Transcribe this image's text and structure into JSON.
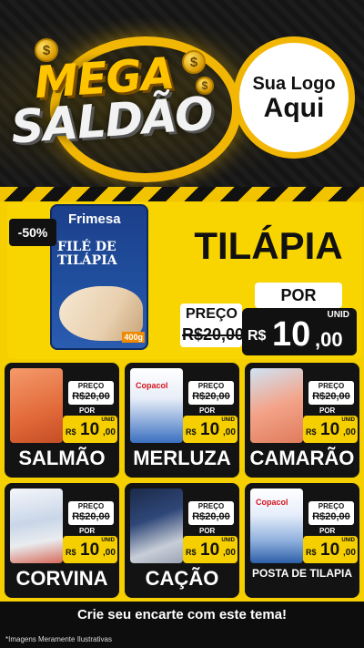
{
  "header": {
    "mega": "MEGA",
    "saldao": "SALDÃO",
    "coin_symbol": "$",
    "logo_line1": "Sua Logo",
    "logo_line2": "Aqui"
  },
  "featured": {
    "discount": "-50%",
    "brand": "Frimesa",
    "package_name": "FILÉ DE TILÁPIA",
    "package_weight": "400g",
    "title": "TILÁPIA",
    "por_label": "POR",
    "preco_label": "PREÇO",
    "old_price": "R$20,00",
    "unid_label": "UNID",
    "currency": "R$",
    "new_price_int": "10",
    "new_price_dec": ",00"
  },
  "products": [
    {
      "name": "SALMÃO",
      "preco_label": "PREÇO",
      "old_price": "R$20,00",
      "por_label": "POR",
      "unid_label": "UNID",
      "currency": "R$",
      "price_int": "10",
      "price_dec": ",00"
    },
    {
      "name": "MERLUZA",
      "brand": "Copacol",
      "preco_label": "PREÇO",
      "old_price": "R$20,00",
      "por_label": "POR",
      "unid_label": "UNID",
      "currency": "R$",
      "price_int": "10",
      "price_dec": ",00"
    },
    {
      "name": "CAMARÃO",
      "preco_label": "PREÇO",
      "old_price": "R$20,00",
      "por_label": "POR",
      "unid_label": "UNID",
      "currency": "R$",
      "price_int": "10",
      "price_dec": ",00"
    },
    {
      "name": "CORVINA",
      "preco_label": "PREÇO",
      "old_price": "R$20,00",
      "por_label": "POR",
      "unid_label": "UNID",
      "currency": "R$",
      "price_int": "10",
      "price_dec": ",00"
    },
    {
      "name": "CAÇÃO",
      "preco_label": "PREÇO",
      "old_price": "R$20,00",
      "por_label": "POR",
      "unid_label": "UNID",
      "currency": "R$",
      "price_int": "10",
      "price_dec": ",00"
    },
    {
      "name": "POSTA DE TILAPIA",
      "brand": "Copacol",
      "preco_label": "PREÇO",
      "old_price": "R$20,00",
      "por_label": "POR",
      "unid_label": "UNID",
      "currency": "R$",
      "price_int": "10",
      "price_dec": ",00"
    }
  ],
  "footer": {
    "cta": "Crie seu encarte com este tema!",
    "note": "*Imagens Meramente Ilustrativas"
  },
  "colors": {
    "accent_yellow": "#f5cf00",
    "ring_gold": "#f2b705",
    "card_dark": "#131313",
    "background": "#0d0d0d"
  }
}
